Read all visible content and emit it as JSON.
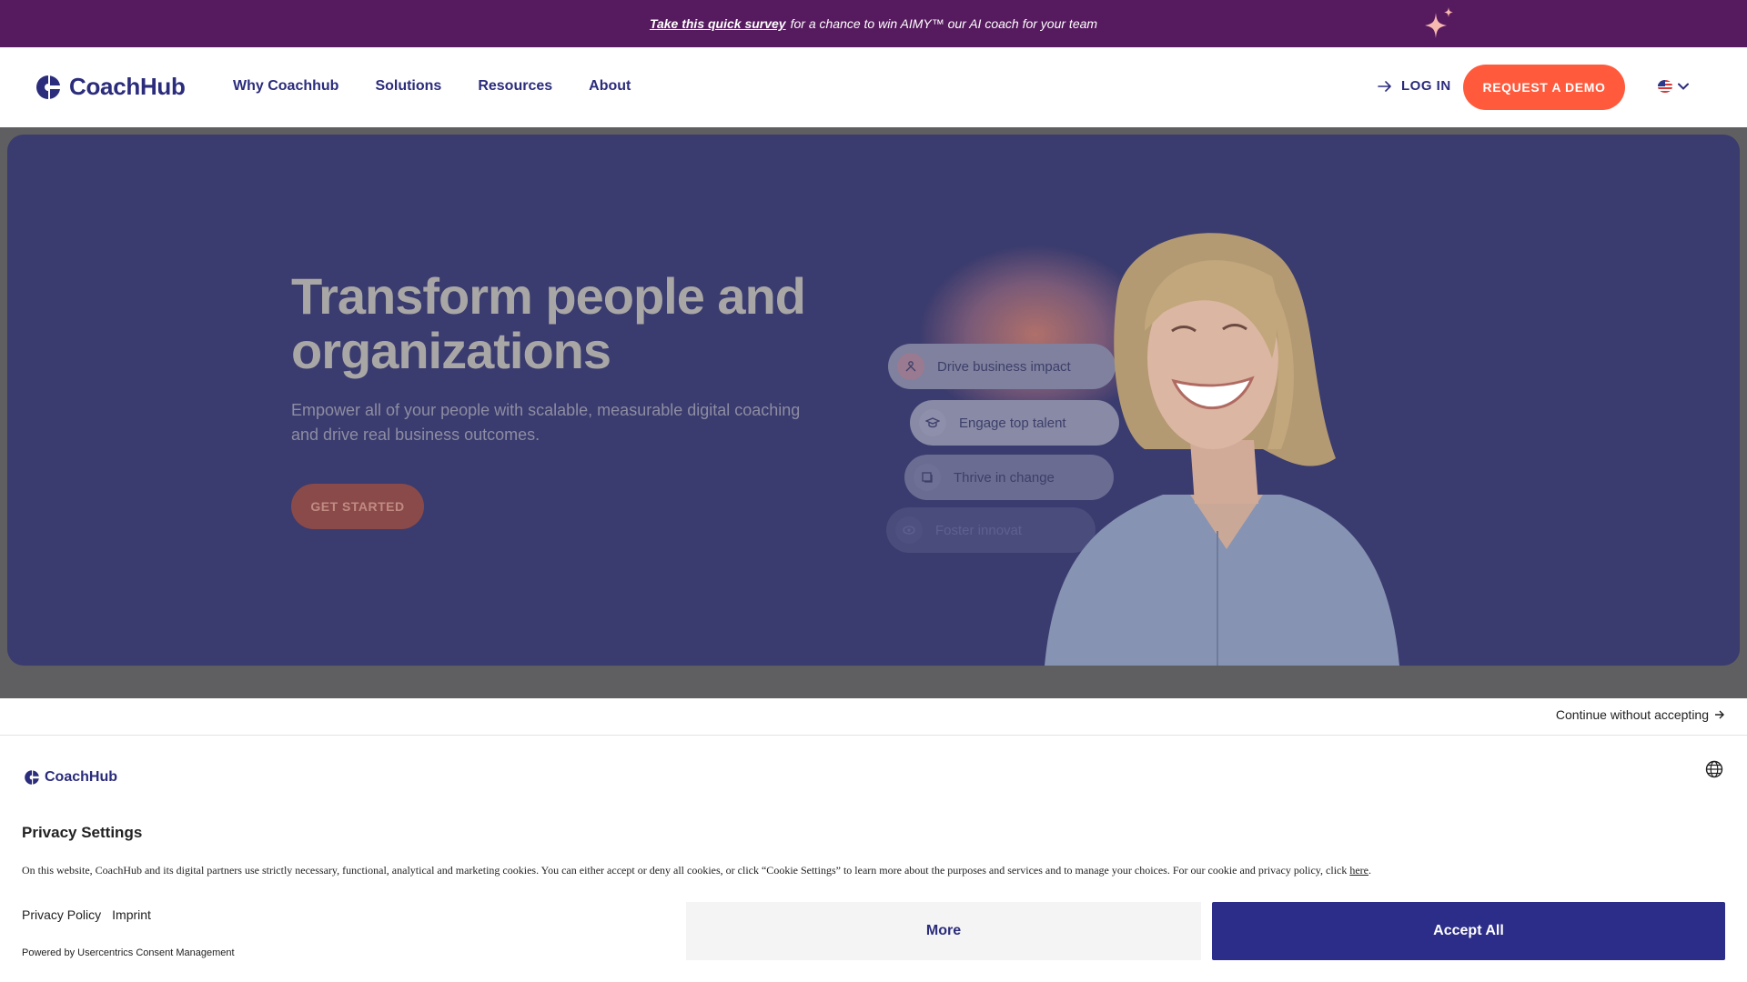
{
  "promo": {
    "link_text": "Take this quick survey",
    "text": "for a chance to win AIMY™ our AI coach for your team",
    "sparkle_icon": "sparkle-icon"
  },
  "header": {
    "brand": "CoachHub",
    "nav": [
      "Why Coachhub",
      "Solutions",
      "Resources",
      "About"
    ],
    "login": "LOG IN",
    "login_icon": "arrow-right-icon",
    "demo": "REQUEST A DEMO",
    "language_icon": "us-flag-icon"
  },
  "hero": {
    "title": "Transform people and organizations",
    "subtitle": "Empower all of your people with scalable, measurable digital coaching and drive real business outcomes.",
    "cta": "GET STARTED",
    "pills": [
      {
        "label": "Drive business impact",
        "icon": "people-network-icon"
      },
      {
        "label": "Engage top talent",
        "icon": "graduation-cap-icon"
      },
      {
        "label": "Thrive in change",
        "icon": "layers-icon"
      },
      {
        "label": "Foster innovat",
        "icon": "eye-icon"
      }
    ]
  },
  "cookie": {
    "continue": "Continue without accepting",
    "brand": "CoachHub",
    "title": "Privacy Settings",
    "text": "On this website, CoachHub and its digital partners use strictly necessary, functional, analytical and marketing cookies. You can either accept or deny all cookies, or click “Cookie Settings” to learn more about the purposes and services and to manage your choices. For our cookie and privacy policy, click",
    "here": "here",
    "policy": "Privacy Policy",
    "imprint": "Imprint",
    "powered": "Powered by Usercentrics Consent Management",
    "more": "More",
    "accept": "Accept All"
  },
  "colors": {
    "banner": "#561a5e",
    "brand_navy": "#2b2c7c",
    "cta_orange": "#ff5a3c",
    "accept_blue": "#2b2d89"
  }
}
